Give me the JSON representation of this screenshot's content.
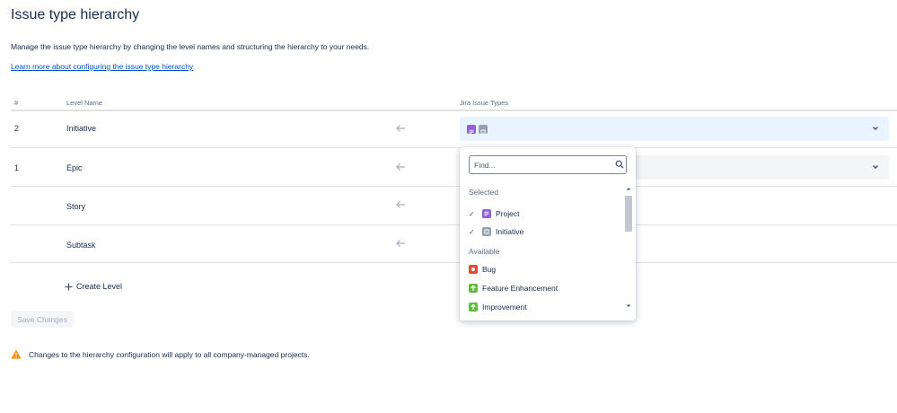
{
  "page": {
    "title": "Issue type hierarchy",
    "description": "Manage the issue type hierarchy by changing the level names and structuring the hierarchy to your needs.",
    "learn_more": "Learn more about configuring the issue type hierarchy"
  },
  "table": {
    "headers": {
      "num": "#",
      "level_name": "Level Name",
      "issue_types": "Jira Issue Types"
    },
    "rows": [
      {
        "num": "2",
        "name": "Initiative"
      },
      {
        "num": "1",
        "name": "Epic"
      },
      {
        "num": "",
        "name": "Story"
      },
      {
        "num": "",
        "name": "Subtask"
      }
    ]
  },
  "actions": {
    "create_level": "Create Level",
    "save_changes": "Save Changes"
  },
  "warning": {
    "text": "Changes to the hierarchy configuration will apply to all company-managed projects."
  },
  "dropdown": {
    "search_placeholder": "Find...",
    "selected_label": "Selected",
    "available_label": "Available",
    "selected": [
      {
        "label": "Project",
        "icon": "project-icon",
        "color": "#8e61d6"
      },
      {
        "label": "Initiative",
        "icon": "initiative-icon",
        "color": "#97a0af"
      }
    ],
    "available": [
      {
        "label": "Bug",
        "icon": "bug-icon",
        "color": "#e5493a"
      },
      {
        "label": "Feature Enhancement",
        "icon": "feature-enhancement-icon",
        "color": "#63ba3c"
      },
      {
        "label": "Improvement",
        "icon": "improvement-icon",
        "color": "#63ba3c"
      }
    ]
  },
  "colors": {
    "link": "#0052cc",
    "active_select_bg": "#e9f2ff",
    "warning": "#ff8b00"
  }
}
